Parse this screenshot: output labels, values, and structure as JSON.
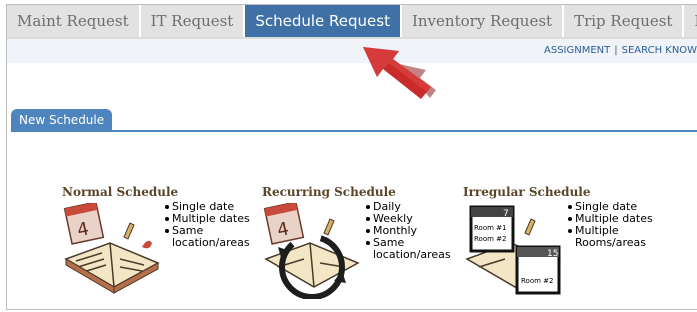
{
  "tabs": [
    {
      "label": "Maint Request"
    },
    {
      "label": "IT Request"
    },
    {
      "label": "Schedule Request"
    },
    {
      "label": "Inventory Request"
    },
    {
      "label": "Trip Request"
    },
    {
      "label": "My Requests"
    }
  ],
  "subnav": {
    "assignment": "ASSIGNMENT",
    "separator": "|",
    "search": "SEARCH KNOW"
  },
  "section_tab": "New Schedule",
  "schedules": [
    {
      "title": "Normal Schedule",
      "bullets": [
        "Single date",
        "Multiple dates",
        "Same location/areas"
      ],
      "icon": "calendar-book-icon"
    },
    {
      "title": "Recurring Schedule",
      "bullets": [
        "Daily",
        "Weekly",
        "Monthly",
        "Same location/areas"
      ],
      "icon": "recurring-calendar-icon"
    },
    {
      "title": "Irregular Schedule",
      "bullets": [
        "Single date",
        "Multiple dates",
        "Multiple Rooms/areas"
      ],
      "icon": "rooms-calendar-icon",
      "room_labels": [
        "Room #1",
        "Room #2",
        "Room #2"
      ],
      "cal_numbers": [
        "7",
        "15"
      ]
    }
  ],
  "colors": {
    "active_tab": "#3f71a6",
    "arrow": "#c92a2a",
    "title": "#5a4528"
  }
}
